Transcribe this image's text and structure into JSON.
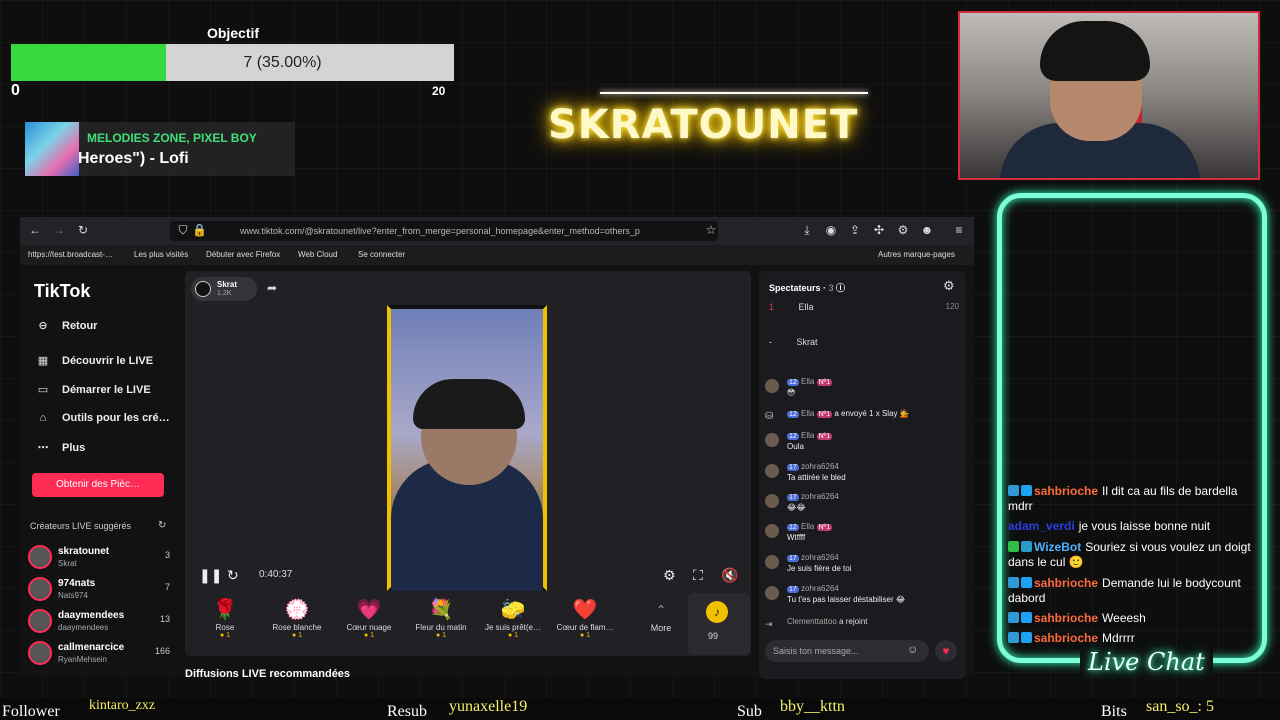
{
  "goal": {
    "title": "Objectif",
    "progress_text": "7 (35.00%)",
    "progress_fraction": 0.35,
    "min": "0",
    "max": "20"
  },
  "music": {
    "artist": "MELODIES ZONE, PIXEL BOY",
    "title": "Heroes\") - Lofi"
  },
  "logo": "SKRATOUNET",
  "browser": {
    "url": "www.tiktok.com/@skratounet/live?enter_from_merge=personal_homepage&enter_method=others_p",
    "bookmarks": [
      "https://test.broadcast-…",
      "Les plus visités",
      "Débuter avec Firefox",
      "Web Cloud",
      "Se connecter",
      "Autres marque-pages"
    ]
  },
  "tiktok": {
    "logo": "TikTok",
    "back": "Retour",
    "nav": [
      "Découvrir le LIVE",
      "Démarrer le LIVE",
      "Outils pour les cré…",
      "Plus"
    ],
    "coins_button": "Obtenir des Pièc…",
    "suggested_title": "Créateurs LIVE suggérés",
    "creators": [
      {
        "name": "skratounet",
        "handle": "Skrat",
        "count": "3"
      },
      {
        "name": "974nats",
        "handle": "Nats974",
        "count": "7"
      },
      {
        "name": "daaymendees",
        "handle": "daaymendees",
        "count": "13"
      },
      {
        "name": "callmenarcice",
        "handle": "RyanMehsein",
        "count": "166"
      }
    ],
    "host": {
      "name": "Skrat",
      "likes": "1.2K"
    },
    "time": "0:40:37",
    "gifts": [
      {
        "icon": "🌹",
        "name": "Rose",
        "price": "1"
      },
      {
        "icon": "💮",
        "name": "Rose blanche",
        "price": "1"
      },
      {
        "icon": "💗",
        "name": "Cœur nuage",
        "price": "1"
      },
      {
        "icon": "💐",
        "name": "Fleur du matin",
        "price": "1"
      },
      {
        "icon": "🧽",
        "name": "Je suis prêt(e…",
        "price": "1"
      },
      {
        "icon": "❤️",
        "name": "Cœur de flam…",
        "price": "1"
      }
    ],
    "more": "More",
    "coins": "99",
    "recommended": "Diffusions LIVE recommandées",
    "spectators_title": "Spectateurs",
    "spectators_count": "3",
    "spectators": [
      {
        "rank": "1",
        "name": "Ella",
        "score": "120"
      },
      {
        "rank": "-",
        "name": "Skrat",
        "score": ""
      }
    ],
    "comments": [
      {
        "user": "Ella",
        "level": "12",
        "badge": "Nº1",
        "text": "😳"
      },
      {
        "user": "Ella",
        "level": "12",
        "badge": "Nº1",
        "text": "a envoyé 1 x Slay 💁"
      },
      {
        "user": "Ella",
        "level": "12",
        "badge": "Nº1",
        "text": "Oula"
      },
      {
        "user": "zohra6264",
        "level": "17",
        "badge": "",
        "text": "Ta attirée le bled"
      },
      {
        "user": "zohra6264",
        "level": "17",
        "badge": "",
        "text": "😂😂"
      },
      {
        "user": "Ella",
        "level": "12",
        "badge": "Nº1",
        "text": "Wtffff"
      },
      {
        "user": "zohra6264",
        "level": "17",
        "badge": "",
        "text": "Je suis fière de toi"
      },
      {
        "user": "zohra6264",
        "level": "17",
        "badge": "",
        "text": "Tu t'es pas laisser déstabiliser 😂"
      }
    ],
    "joined": {
      "user": "Clementtattoo",
      "text": "a rejoint"
    },
    "input_placeholder": "Saisis ton message..."
  },
  "live_chat": {
    "title": "Live Chat",
    "messages": [
      {
        "user": "sahbrioche",
        "color": "#ff6a3d",
        "text": "Il dit ca au fils de bardella mdrr"
      },
      {
        "user": "adam_verdi",
        "color": "#2b3ee0",
        "text": "je vous laisse bonne nuit"
      },
      {
        "user": "WizeBot",
        "color": "#4ab0ff",
        "text": "Souriez si vous voulez un doigt dans le cul 🙂"
      },
      {
        "user": "sahbrioche",
        "color": "#ff6a3d",
        "text": "Demande lui le bodycount dabord"
      },
      {
        "user": "sahbrioche",
        "color": "#ff6a3d",
        "text": "Weeesh"
      },
      {
        "user": "sahbrioche",
        "color": "#ff6a3d",
        "text": "Mdrrrr"
      }
    ]
  },
  "bottom_bar": {
    "follower_label": "Follower",
    "follower_value": "kintaro_zxz",
    "resub_label": "Resub",
    "resub_value": "yunaxelle19",
    "sub_label": "Sub",
    "sub_value": "bby__kttn",
    "bits_label": "Bits",
    "bits_value": "san_so_: 5"
  }
}
